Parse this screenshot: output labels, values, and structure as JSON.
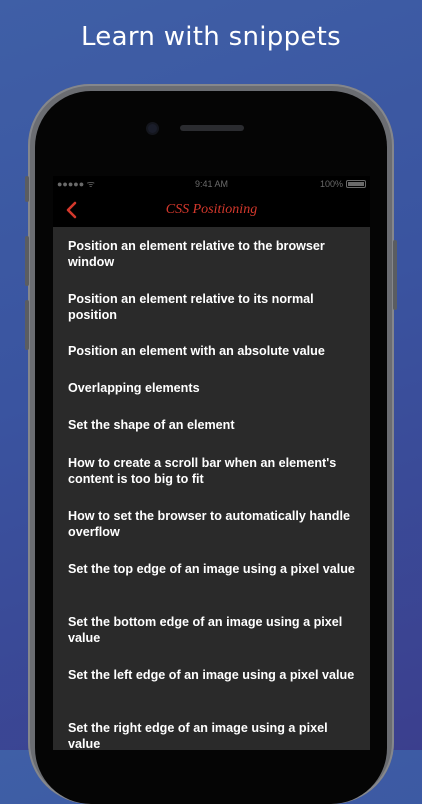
{
  "headline": "Learn with snippets",
  "status_bar": {
    "carrier": "●●●●● ᯤ",
    "time": "9:41 AM",
    "battery": "100%"
  },
  "nav": {
    "title": "CSS Positioning",
    "back_icon": "chevron-left-icon",
    "accent_color": "#d4382c"
  },
  "items": [
    {
      "label": "Position an element relative to the browser window",
      "lines": 2
    },
    {
      "label": "Position an element relative to its normal position",
      "lines": 2
    },
    {
      "label": "Position an element with an absolute value",
      "lines": 1
    },
    {
      "label": "Overlapping elements",
      "lines": 1
    },
    {
      "label": "Set the shape of an element",
      "lines": 1
    },
    {
      "label": "How to create a scroll bar when an element's content is too big to fit",
      "lines": 2
    },
    {
      "label": "How to set the browser to automatically handle overflow",
      "lines": 2
    },
    {
      "label": "Set the top edge of an image using a pixel value",
      "lines": 2
    },
    {
      "label": "Set the bottom edge of an image using a pixel value",
      "lines": 2
    },
    {
      "label": "Set the left edge of an image using a pixel value",
      "lines": 2
    },
    {
      "label": "Set the right edge of an image using a pixel value",
      "lines": 2
    }
  ]
}
